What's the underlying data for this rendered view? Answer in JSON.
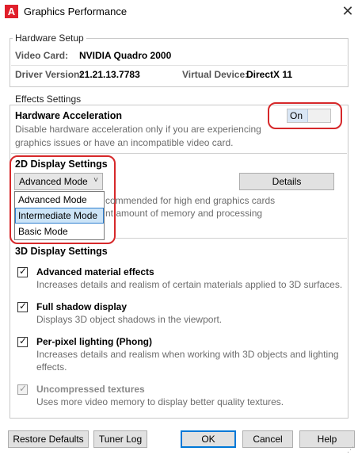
{
  "window": {
    "title": "Graphics Performance",
    "icon": "autocad-a-icon"
  },
  "hardware_setup": {
    "legend": "Hardware Setup",
    "video_card_label": "Video Card:",
    "video_card_value": "NVIDIA Quadro 2000",
    "driver_label": "Driver Version:",
    "driver_value": "21.21.13.7783",
    "virtual_device_label": "Virtual Device:",
    "virtual_device_value": "DirectX 11"
  },
  "effects": {
    "legend": "Effects Settings",
    "hw_accel_title": "Hardware Acceleration",
    "hw_accel_desc_1": "Disable hardware acceleration only if you are experiencing",
    "hw_accel_desc_2": "graphics issues or have an incompatible video card.",
    "toggle_label": "On",
    "display2d_title": "2D Display Settings",
    "mode_selected": "Advanced Mode",
    "details_button": "Details",
    "mode_desc_1": "commended for high end graphics cards",
    "mode_desc_2": "nt amount of memory and processing",
    "mode_options": [
      "Advanced Mode",
      "Intermediate Mode",
      "Basic Mode"
    ],
    "display3d_title": "3D Display Settings",
    "options": [
      {
        "title": "Advanced material effects",
        "desc": "Increases details and realism of certain materials applied to 3D surfaces.",
        "checked": true,
        "enabled": true
      },
      {
        "title": "Full shadow display",
        "desc": "Displays 3D object shadows in the viewport.",
        "checked": true,
        "enabled": true
      },
      {
        "title": "Per-pixel lighting (Phong)",
        "desc": "Increases details and realism when working with 3D objects and lighting effects.",
        "checked": true,
        "enabled": true
      },
      {
        "title": "Uncompressed textures",
        "desc": "Uses more video memory to display better quality textures.",
        "checked": true,
        "enabled": false
      }
    ]
  },
  "footer": {
    "restore": "Restore Defaults",
    "tuner": "Tuner Log",
    "ok": "OK",
    "cancel": "Cancel",
    "help": "Help"
  },
  "colors": {
    "highlight_ring": "#d6282a",
    "selected_item": "#cce4f7",
    "accent": "#0078d7"
  }
}
